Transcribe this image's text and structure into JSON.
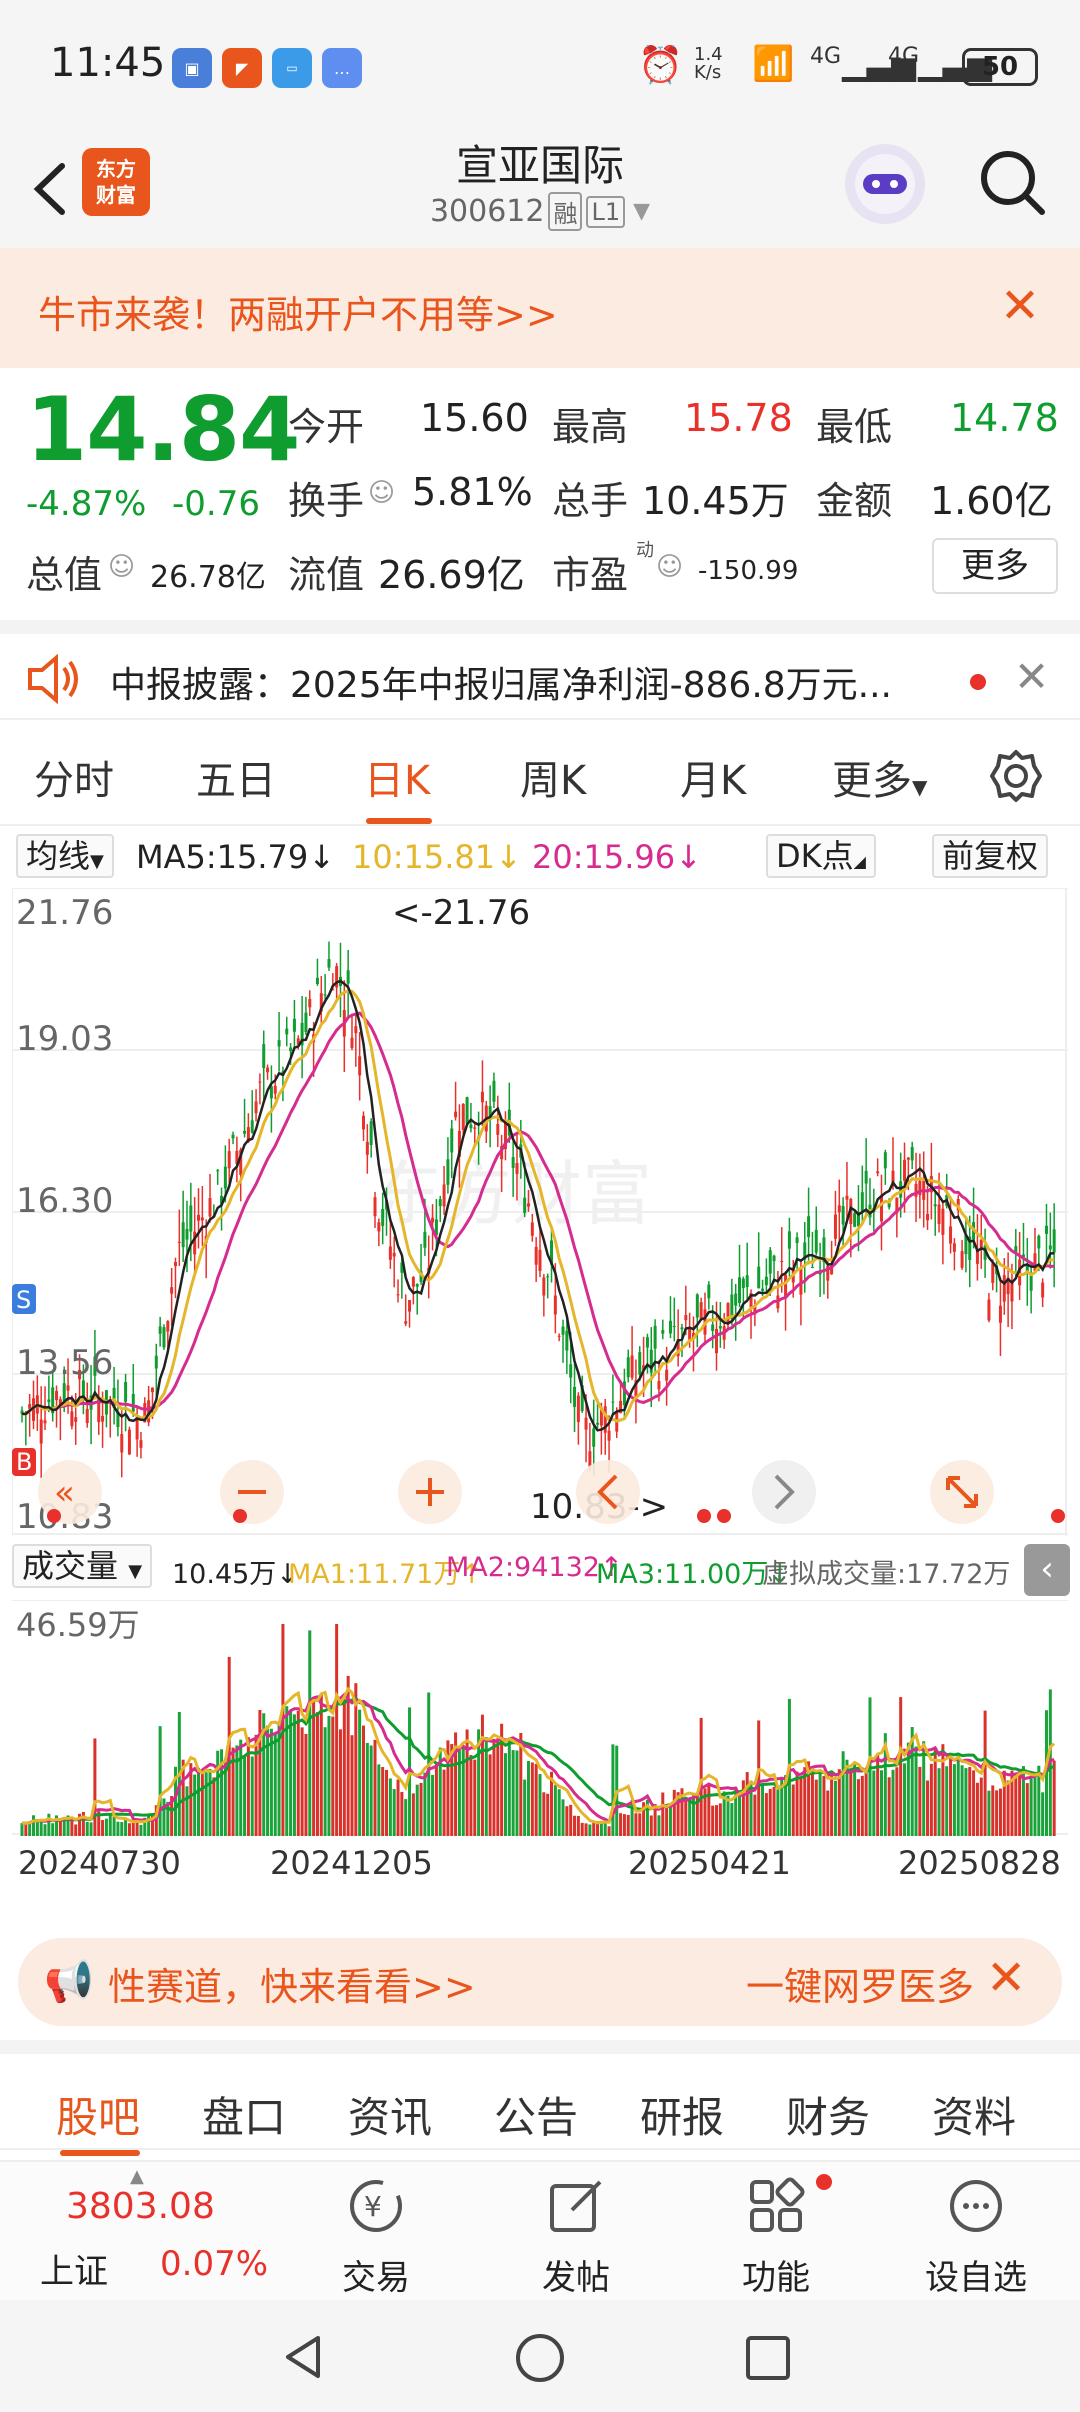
{
  "status_bar": {
    "time": "11:45",
    "net_speed": "1.4\nK/s",
    "signal1": "4G",
    "signal2": "4G",
    "battery": "50"
  },
  "header": {
    "brand": "东方\n财富",
    "stock_name": "宣亚国际",
    "stock_code": "300612",
    "code_tags": [
      "融",
      "L1"
    ]
  },
  "promo": {
    "text": "牛市来袭！两融开户不用等>>"
  },
  "quote": {
    "price": "14.84",
    "change_pct": "-4.87%",
    "change_abs": "-0.76",
    "open_label": "今开",
    "open": "15.60",
    "high_label": "最高",
    "high": "15.78",
    "low_label": "最低",
    "low": "14.78",
    "turnover_label": "换手",
    "turnover": "5.81%",
    "volume_label": "总手",
    "volume": "10.45万",
    "amount_label": "金额",
    "amount": "1.60亿",
    "mktcap_label": "总值",
    "mktcap": "26.78亿",
    "float_label": "流值",
    "float_cap": "26.69亿",
    "pe_label": "市盈",
    "pe_sup": "动",
    "pe": "-150.99",
    "more": "更多"
  },
  "notice": {
    "text": "中报披露：2025年中报归属净利润-886.8万元..."
  },
  "period_tabs": [
    "分时",
    "五日",
    "日K",
    "周K",
    "月K",
    "更多"
  ],
  "ma_row": {
    "selector": "均线",
    "ma5": "MA5:15.79",
    "ma10": "10:15.81",
    "ma20": "20:15.96",
    "dk": "DK点",
    "adjust": "前复权"
  },
  "kline": {
    "y_labels": [
      "21.76",
      "19.03",
      "16.30",
      "13.56",
      "10.83"
    ],
    "max_marker": "<-21.76",
    "min_marker": "10.83->"
  },
  "vol_row": {
    "selector": "成交量",
    "vol": "10.45万",
    "ma1": "MA1:11.71万",
    "ma2": "MA2:94132",
    "ma3": "MA3:11.00万",
    "virtual": "虚拟成交量:17.72万",
    "y_label": "46.59万"
  },
  "dates": [
    "20240730",
    "20241205",
    "20250421",
    "20250828"
  ],
  "ad": {
    "left": "性赛道，快来看看>>",
    "right": "一键网罗医多"
  },
  "bottom_tabs": [
    "股吧",
    "盘口",
    "资讯",
    "公告",
    "研报",
    "财务",
    "资料"
  ],
  "toolbar": {
    "index_val": "3803.08",
    "index_name": "上证",
    "index_pct": "0.07%",
    "items": [
      "交易",
      "发帖",
      "功能",
      "设自选"
    ]
  },
  "colors": {
    "accent": "#e9561d",
    "up": "#e8312a",
    "down": "#0f9d2f",
    "ma5": "#222222",
    "ma10": "#e5b52a",
    "ma20": "#d62b8f"
  }
}
